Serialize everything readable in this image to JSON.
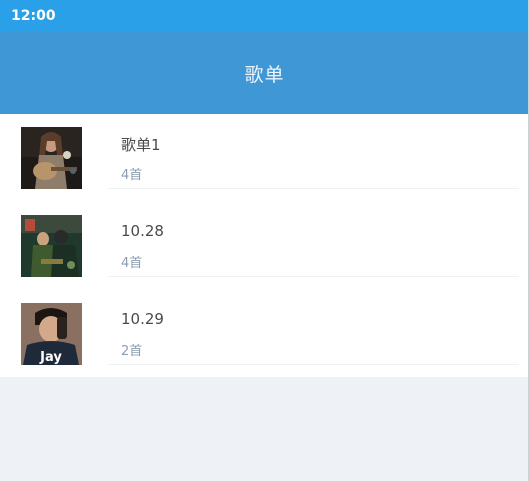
{
  "status_bar": {
    "time": "12:00"
  },
  "app_bar": {
    "title": "歌单"
  },
  "playlists": [
    {
      "name": "歌单1",
      "count": "4首"
    },
    {
      "name": "10.28",
      "count": "4首"
    },
    {
      "name": "10.29",
      "count": "2首",
      "cover_text": "Jay"
    }
  ],
  "colors": {
    "status_bar": "#2aa0e8",
    "app_bar": "#3f97d6",
    "list_bg": "#ffffff",
    "page_bg": "#eef2f6",
    "count_text": "#8c9db1"
  }
}
